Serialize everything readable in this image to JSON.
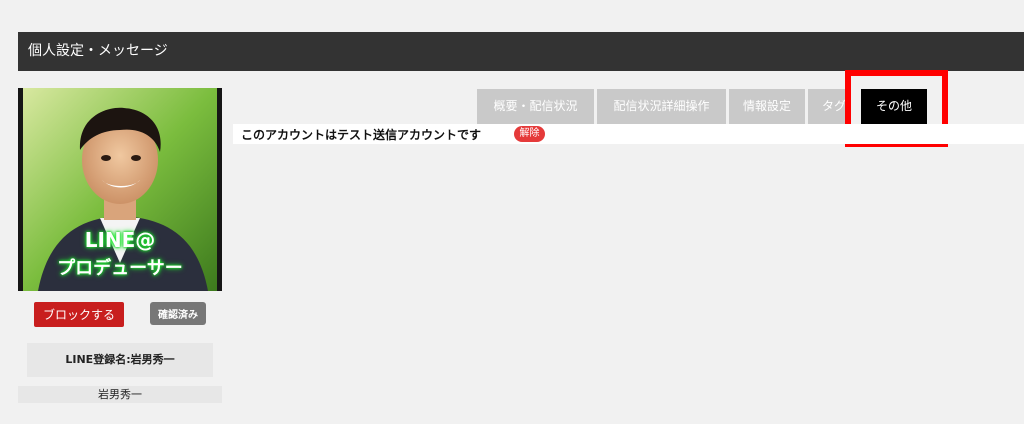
{
  "header": {
    "title": "個人設定・メッセージ"
  },
  "profile": {
    "avatar_overlay_line1": "LINE@",
    "avatar_overlay_line2": "プロデューサー",
    "block_button": "ブロックする",
    "confirmed_button": "確認済み",
    "line_name": "LINE登録名:岩男秀一",
    "display_name": "岩男秀一"
  },
  "tabs": [
    {
      "label": "概要・配信状況"
    },
    {
      "label": "配信状況詳細操作"
    },
    {
      "label": "情報設定"
    },
    {
      "label": "タグ"
    },
    {
      "label": "その他",
      "active": true
    }
  ],
  "notice": {
    "text": "このアカウントはテスト送信アカウントです",
    "release_label": "解除"
  },
  "colors": {
    "header_bg": "#333333",
    "tab_bg": "#c9c9c9",
    "active_tab_bg": "#000000",
    "block_button": "#c81e1e",
    "release_badge": "#e53a3a",
    "highlight": "#ff0000"
  }
}
